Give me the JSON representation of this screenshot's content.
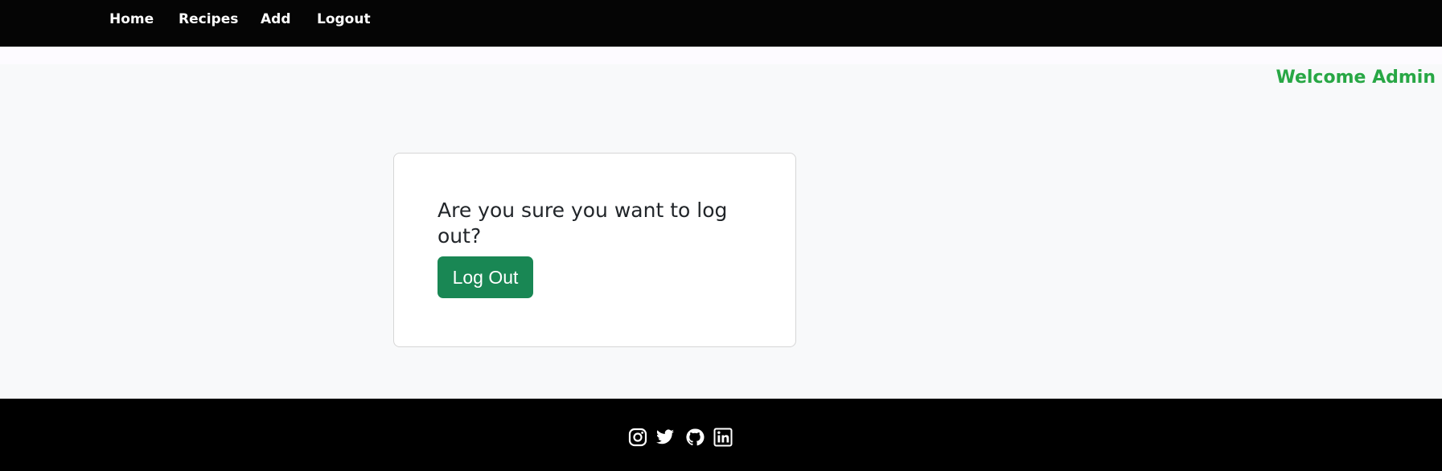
{
  "nav": {
    "items": [
      {
        "label": "Home"
      },
      {
        "label": "Recipes"
      },
      {
        "label": "Add"
      },
      {
        "label": "Logout"
      }
    ]
  },
  "header": {
    "welcome": "Welcome Admin"
  },
  "card": {
    "question": "Are you sure you want to log out?",
    "button_label": "Log Out"
  },
  "footer": {
    "social_icons": [
      "instagram-icon",
      "twitter-icon",
      "github-icon",
      "linkedin-icon"
    ]
  },
  "colors": {
    "navbar_bg": "#050505",
    "accent_green": "#28a745",
    "button_green": "#198754",
    "footer_bg": "#000000"
  }
}
